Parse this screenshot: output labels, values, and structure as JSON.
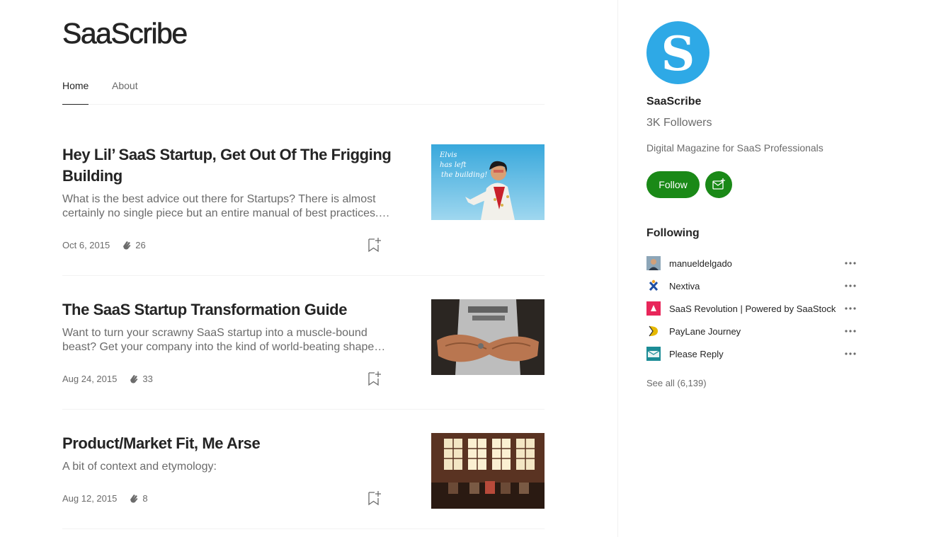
{
  "publication": {
    "title": "SaaScribe",
    "tabs": [
      {
        "label": "Home",
        "active": true
      },
      {
        "label": "About",
        "active": false
      }
    ]
  },
  "articles": [
    {
      "title": "Hey Lil’ SaaS Startup, Get Out Of The Frigging Building",
      "subtitle": "What is the best advice out there for Startups? There is almost certainly no single piece but an entire manual of best practices. I…",
      "date": "Oct 6, 2015",
      "claps": "26",
      "image_text": "Elvis has left the building!"
    },
    {
      "title": "The SaaS Startup Transformation Guide",
      "subtitle": "Want to turn your scrawny SaaS startup into a muscle-bound beast? Get your company into the kind of world-beating shape…",
      "date": "Aug 24, 2015",
      "claps": "33"
    },
    {
      "title": "Product/Market Fit, Me Arse",
      "subtitle": "A bit of context and etymology:",
      "date": "Aug 12, 2015",
      "claps": "8"
    }
  ],
  "sidebar": {
    "logo_letter": "S",
    "name": "SaaScribe",
    "followers": "3K Followers",
    "description": "Digital Magazine for SaaS Professionals",
    "follow_label": "Follow",
    "following_heading": "Following",
    "following": [
      {
        "name": "manueldelgado"
      },
      {
        "name": "Nextiva"
      },
      {
        "name": "SaaS Revolution | Powered by SaaStock"
      },
      {
        "name": "PayLane Journey"
      },
      {
        "name": "Please Reply"
      }
    ],
    "see_all": "See all (6,139)"
  },
  "colors": {
    "accent_green": "#1a8917",
    "logo_blue": "#2ea9e6",
    "text_primary": "#242424",
    "text_secondary": "#6b6b6b"
  }
}
